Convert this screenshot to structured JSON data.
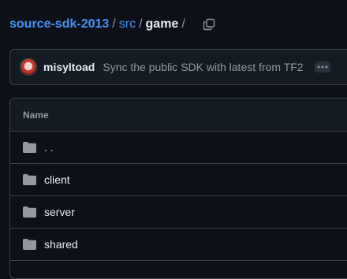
{
  "breadcrumb": {
    "repo": "source-sdk-2013",
    "sep1": "/",
    "dir1": "src",
    "sep2": "/",
    "current": "game",
    "sep3": "/"
  },
  "commit": {
    "author": "misyltoad",
    "message": "Sync the public SDK with latest from TF2"
  },
  "files": {
    "header": "Name",
    "rows": [
      {
        "name": ". .",
        "icon": "folder-icon"
      },
      {
        "name": "client",
        "icon": "folder-icon"
      },
      {
        "name": "server",
        "icon": "folder-icon"
      },
      {
        "name": "shared",
        "icon": "folder-icon"
      }
    ]
  },
  "colors": {
    "background": "#0d1117",
    "link": "#4493f8",
    "border": "#3d444d",
    "muted": "#9198a1"
  }
}
